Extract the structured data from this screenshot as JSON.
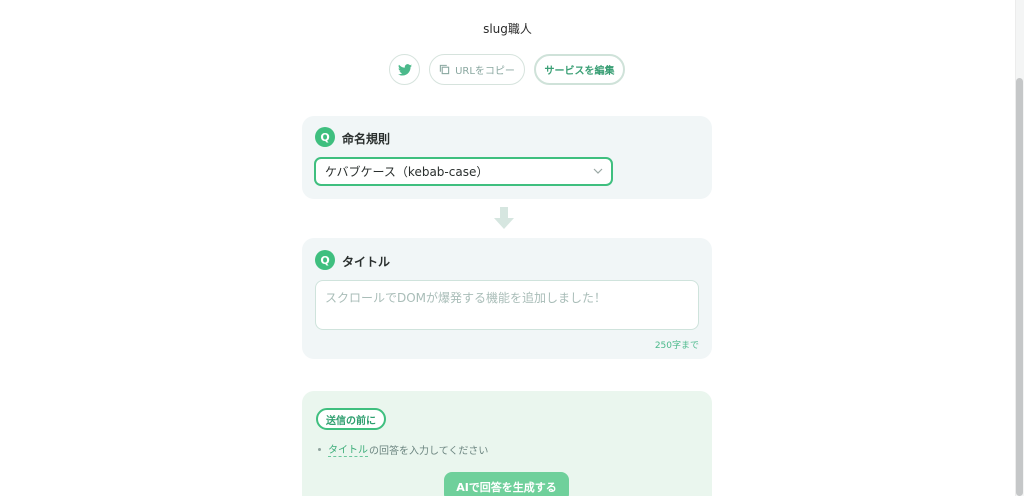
{
  "header": {
    "service_name": "slug職人"
  },
  "actions": {
    "twitter_icon": "twitter-bird-icon",
    "copy_url_label": "URLをコピー",
    "edit_service_label": "サービスを編集"
  },
  "questions": [
    {
      "badge": "Q",
      "label": "命名規則",
      "select_value": "ケバブケース（kebab-case）"
    },
    {
      "badge": "Q",
      "label": "タイトル",
      "placeholder": "スクロールでDOMが爆発する機能を追加しました！",
      "char_limit": "250字まで"
    }
  ],
  "submit": {
    "before_label": "送信の前に",
    "notice_link": "タイトル",
    "notice_text": "の回答を入力してください",
    "generate_label": "AIで回答を生成する"
  },
  "colors": {
    "accent": "#3fbf7f",
    "card_bg": "#f1f6f7",
    "panel_bg": "#eaf6ee"
  }
}
